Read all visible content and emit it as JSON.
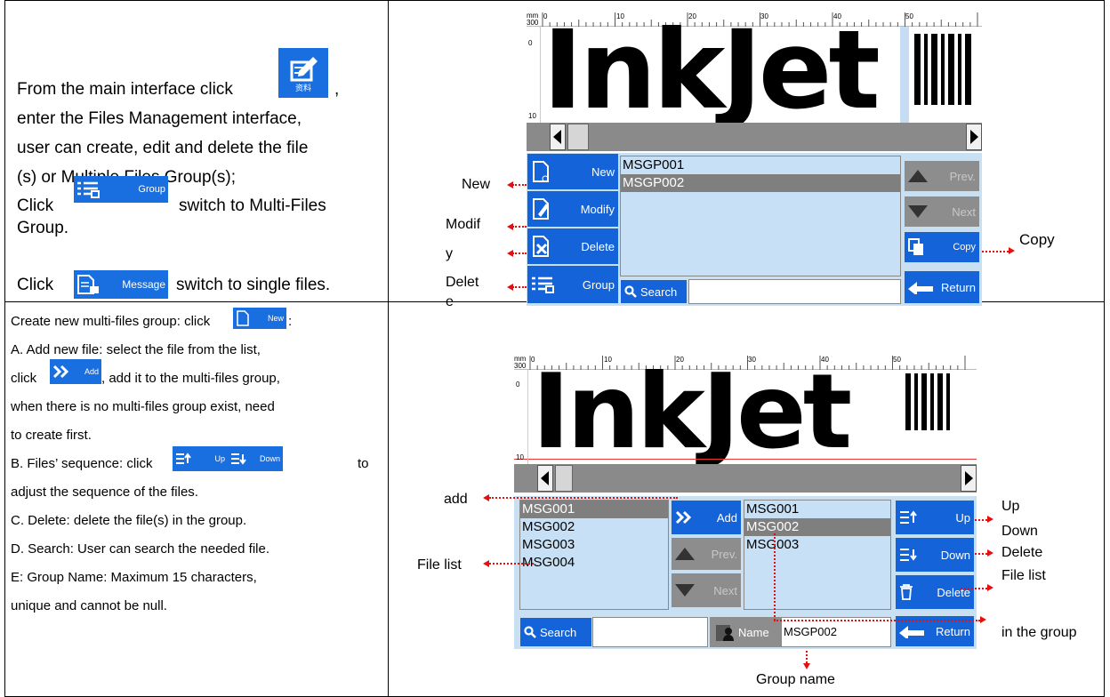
{
  "sec1": {
    "line1": "From the main interface click",
    "line1_end": ",",
    "icon_data_label": "资料",
    "line2": "enter the Files Management interface,",
    "line3": "user can create, edit and delete the file",
    "line4": "(s) or Multiple Files Group(s);",
    "click1": "Click",
    "group_btn": "Group",
    "switch_multi": "switch to Multi-Files",
    "group_word": "Group.",
    "click2": "Click",
    "message_btn": "Message",
    "switch_single": "switch to single files."
  },
  "sec2": {
    "l1": "Create new multi-files group: click",
    "l1_end": ":",
    "new_btn": "New",
    "l2": "A. Add new file: select the file from the list,",
    "l3a": "click",
    "add_btn": "Add",
    "l3b": ", add it to the multi-files group,",
    "l4": "when there is no multi-files group exist, need",
    "l5": "to create first.",
    "l6a": "B. Files’ sequence: click",
    "up_btn": "Up",
    "down_btn": "Down",
    "l6b": "to",
    "l7": "adjust the sequence of the files.",
    "l8": "C. Delete: delete the file(s) in the group.",
    "l9": "D. Search: User can search the needed file.",
    "l10": "E: Group Name: Maximum 15 characters,",
    "l11": "unique and cannot be null."
  },
  "screen1": {
    "mm": "mm",
    "mm2": "300",
    "ruler": [
      "0",
      "10",
      "20",
      "30",
      "40",
      "50"
    ],
    "lruler": [
      "0",
      "10"
    ],
    "canvas_text": "InkJet",
    "buttons": {
      "new": "New",
      "modify": "Modify",
      "delete": "Delete",
      "group": "Group",
      "prev": "Prev.",
      "next": "Next",
      "copy": "Copy",
      "return": "Return",
      "search": "Search"
    },
    "list": [
      "MSGP001",
      "MSGP002"
    ],
    "ann": {
      "new": "New",
      "modify_a": "Modif",
      "modify_b": "y",
      "delete_a": "Delet",
      "delete_b": "e",
      "copy": "Copy"
    }
  },
  "screen2": {
    "mm": "mm",
    "mm2": "300",
    "ruler": [
      "0",
      "10",
      "20",
      "30",
      "40",
      "50"
    ],
    "lruler": [
      "0",
      "10"
    ],
    "canvas_text": "InkJet",
    "left_list": [
      "MSG001",
      "MSG002",
      "MSG003",
      "MSG004"
    ],
    "right_list": [
      "MSG001",
      "MSG002",
      "MSG003"
    ],
    "buttons": {
      "add": "Add",
      "prev": "Prev.",
      "next": "Next",
      "up": "Up",
      "down": "Down",
      "delete": "Delete",
      "return": "Return",
      "search": "Search",
      "name": "Name"
    },
    "group_name": "MSGP002",
    "ann": {
      "add": "add",
      "file_list": "File list",
      "up": "Up",
      "down": "Down",
      "delete": "Delete",
      "file_list2": "File list",
      "in_group": "in the group",
      "group_name": "Group name"
    }
  }
}
